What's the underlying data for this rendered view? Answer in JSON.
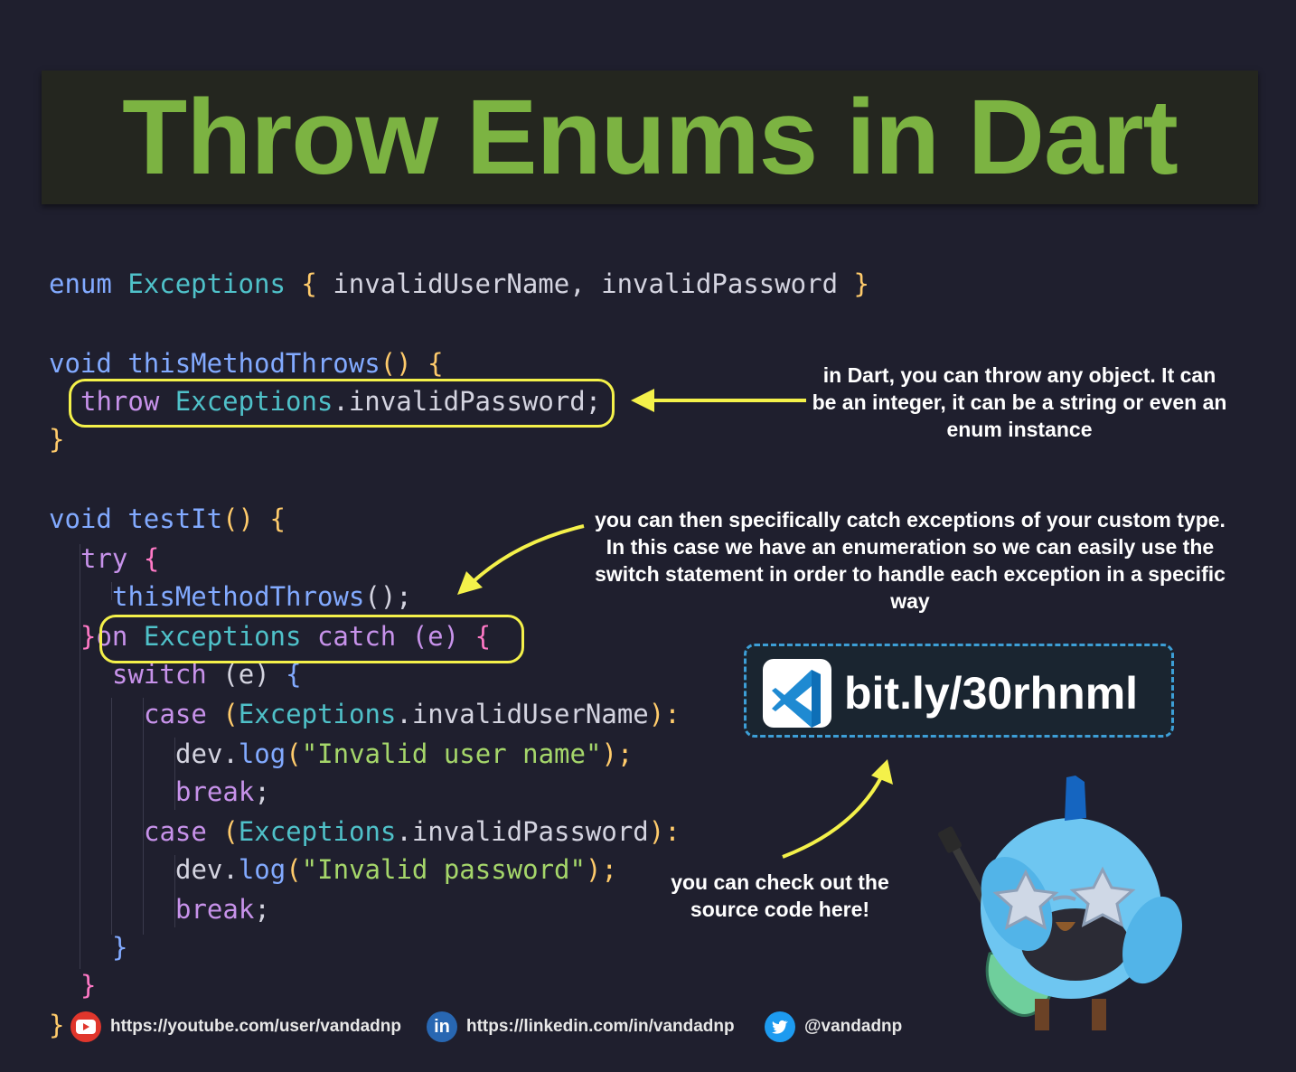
{
  "title": "Throw Enums in Dart",
  "code": {
    "line1": {
      "kw": "enum",
      "type": "Exceptions",
      "open": "{",
      "members": "invalidUserName, invalidPassword",
      "close": "}"
    },
    "line2": {
      "kw": "void",
      "fn": "thisMethodThrows",
      "parens": "()",
      "open": "{"
    },
    "line3": {
      "kw": "throw",
      "type": "Exceptions",
      "rest": ".invalidPassword;"
    },
    "line4": {
      "close": "}"
    },
    "line5": {
      "kw": "void",
      "fn": "testIt",
      "parens": "()",
      "open": "{"
    },
    "line6": {
      "kw": "try",
      "open": "{"
    },
    "line7": {
      "fn": "thisMethodThrows",
      "rest": "();"
    },
    "line8": {
      "close": "}",
      "on": "on",
      "type": "Exceptions",
      "catch": "catch",
      "arg": "(e)",
      "open": "{"
    },
    "line9": {
      "kw": "switch",
      "arg": "(e)",
      "open": "{"
    },
    "line10": {
      "kw": "case",
      "open": "(",
      "type": "Exceptions",
      "member": ".invalidUserName",
      "close": "):"
    },
    "line11": {
      "obj": "dev.",
      "fn": "log",
      "open": "(",
      "str": "\"Invalid user name\"",
      "close": ");"
    },
    "line12": {
      "kw": "break",
      "semi": ";"
    },
    "line13": {
      "kw": "case",
      "open": "(",
      "type": "Exceptions",
      "member": ".invalidPassword",
      "close": "):"
    },
    "line14": {
      "obj": "dev.",
      "fn": "log",
      "open": "(",
      "str": "\"Invalid password\"",
      "close": ");"
    },
    "line15": {
      "kw": "break",
      "semi": ";"
    },
    "line16": {
      "close": "}"
    },
    "line17": {
      "close": "}"
    },
    "line18": {
      "close": "}"
    }
  },
  "notes": {
    "throw_note": "in Dart, you can throw any object. It can be an integer, it can be a string or even an enum instance",
    "catch_note": "you can then specifically catch exceptions of your custom type. In this case we have an enumeration so we can easily use the switch statement in order to handle each exception in a specific way",
    "source_note": "you can check out the source code here!"
  },
  "link": {
    "text": "bit.ly/30rhnml",
    "icon": "vscode-icon"
  },
  "footer": {
    "youtube": {
      "icon": "youtube-icon",
      "text": "https://youtube.com/user/vandadnp"
    },
    "linkedin": {
      "icon": "linkedin-icon",
      "text": "https://linkedin.com/in/vandadnp"
    },
    "twitter": {
      "icon": "twitter-icon",
      "text": "@vandadnp"
    }
  },
  "colors": {
    "title": "#7cb342",
    "highlight": "#f4f14a",
    "link_border": "#3d9ed6"
  }
}
